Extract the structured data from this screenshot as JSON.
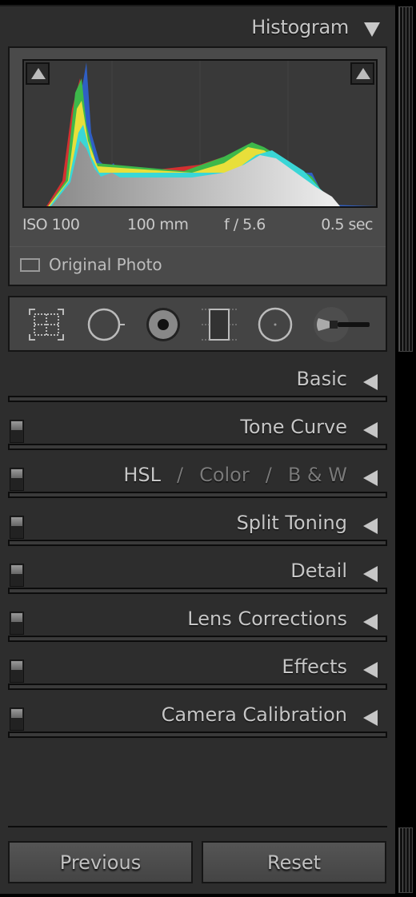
{
  "histogram": {
    "title": "Histogram",
    "exif": {
      "iso": "ISO 100",
      "focal_length": "100 mm",
      "aperture": "f / 5.6",
      "shutter": "0.5 sec"
    },
    "original_photo_label": "Original Photo",
    "original_photo_checked": false
  },
  "tools": [
    {
      "name": "crop-overlay-icon"
    },
    {
      "name": "spot-removal-icon"
    },
    {
      "name": "red-eye-correction-icon",
      "active": false
    },
    {
      "name": "graduated-filter-icon"
    },
    {
      "name": "radial-filter-icon"
    },
    {
      "name": "adjustment-brush-icon"
    }
  ],
  "sections": [
    {
      "label": "Basic",
      "has_switch": false
    },
    {
      "label": "Tone Curve",
      "has_switch": true
    },
    {
      "label_parts": [
        "HSL",
        "/",
        "Color",
        "/",
        "B & W"
      ],
      "has_switch": true
    },
    {
      "label": "Split Toning",
      "has_switch": true
    },
    {
      "label": "Detail",
      "has_switch": true
    },
    {
      "label": "Lens Corrections",
      "has_switch": true
    },
    {
      "label": "Effects",
      "has_switch": true
    },
    {
      "label": "Camera Calibration",
      "has_switch": true
    }
  ],
  "buttons": {
    "previous": "Previous",
    "reset": "Reset"
  }
}
